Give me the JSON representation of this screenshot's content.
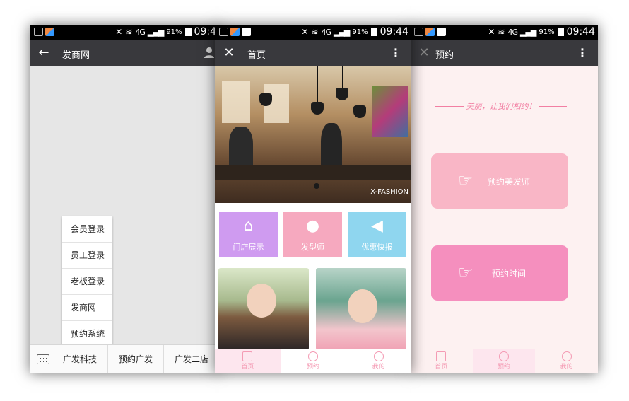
{
  "phone1": {
    "status": {
      "time": "09:4",
      "battery": "91%",
      "network": "4G"
    },
    "appbar": {
      "back_icon": "arrow-left-icon",
      "title": "发商网"
    },
    "menu": [
      "会员登录",
      "员工登录",
      "老板登录",
      "发商网",
      "预约系统"
    ],
    "bottom_tabs": [
      "广发科技",
      "预约广发",
      "广发二店"
    ]
  },
  "phone2": {
    "status": {
      "time": "09:44",
      "battery": "91%",
      "network": "4G"
    },
    "appbar": {
      "close_icon": "close-icon",
      "title": "首页"
    },
    "hero_caption": "X-FASHION",
    "tiles": [
      {
        "label": "门店展示",
        "icon": "store-icon",
        "color": "#cf9bf0"
      },
      {
        "label": "发型师",
        "icon": "stylist-icon",
        "color": "#f6a9bf"
      },
      {
        "label": "优惠快报",
        "icon": "megaphone-icon",
        "color": "#8fd6ef"
      }
    ],
    "tabs": [
      "首页",
      "预约",
      "我的"
    ]
  },
  "phone3": {
    "status": {
      "time": "09:44",
      "battery": "91%",
      "network": "4G"
    },
    "appbar": {
      "title": "预约"
    },
    "slogan": "美丽，让我们相约！",
    "buttons": [
      "预约美发师",
      "预约时间"
    ],
    "tabs": [
      "首页",
      "预约",
      "我的"
    ],
    "accent": "#f58fbe"
  }
}
